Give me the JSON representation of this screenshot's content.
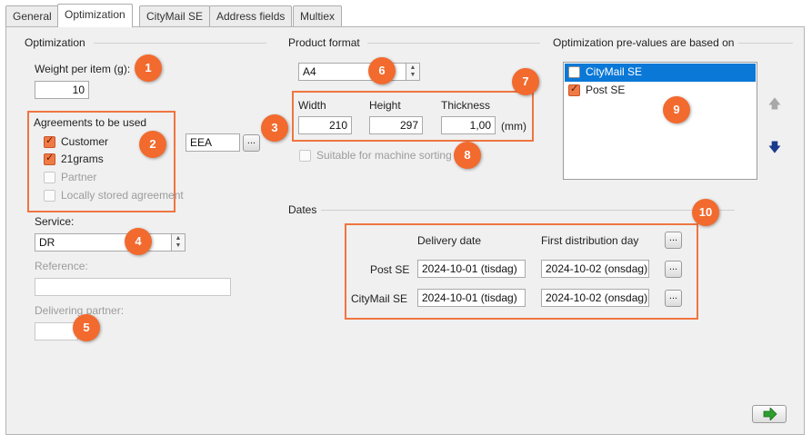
{
  "tabs": [
    {
      "label": "General",
      "active": false
    },
    {
      "label": "Optimization",
      "active": true
    },
    {
      "label": "CityMail SE",
      "active": false
    },
    {
      "label": "Address fields",
      "active": false
    },
    {
      "label": "Multiex",
      "active": false
    }
  ],
  "optimization": {
    "section_title": "Optimization",
    "weight_label": "Weight per item (g):",
    "weight_value": "10",
    "agreements_label": "Agreements to be used",
    "agreements": [
      {
        "label": "Customer",
        "checked": true,
        "enabled": true
      },
      {
        "label": "21grams",
        "checked": true,
        "enabled": true
      },
      {
        "label": "Partner",
        "checked": false,
        "enabled": false
      },
      {
        "label": "Locally stored agreement",
        "checked": false,
        "enabled": false
      }
    ],
    "eea_value": "EEA",
    "browse_label": "...",
    "service_label": "Service:",
    "service_value": "DR",
    "reference_label": "Reference:",
    "reference_value": "",
    "delivering_partner_label": "Delivering partner:",
    "delivering_partner_value": ""
  },
  "product_format": {
    "section_title": "Product format",
    "format_value": "A4",
    "width_label": "Width",
    "height_label": "Height",
    "thickness_label": "Thickness",
    "width_value": "210",
    "height_value": "297",
    "thickness_value": "1,00",
    "unit_label": "(mm)",
    "machine_sorting_label": "Suitable for machine sorting",
    "machine_sorting_checked": false
  },
  "prevalues": {
    "section_title": "Optimization pre-values are based on",
    "items": [
      {
        "label": "CityMail SE",
        "checked": false,
        "selected": true
      },
      {
        "label": "Post SE",
        "checked": true,
        "selected": false
      }
    ]
  },
  "dates": {
    "section_title": "Dates",
    "col_delivery": "Delivery date",
    "col_first": "First distribution day",
    "browse_label": "...",
    "rows": [
      {
        "label": "Post SE",
        "delivery": "2024-10-01 (tisdag)",
        "first": "2024-10-02 (onsdag)"
      },
      {
        "label": "CityMail SE",
        "delivery": "2024-10-01 (tisdag)",
        "first": "2024-10-02 (onsdag)"
      }
    ]
  },
  "badges": [
    "1",
    "2",
    "3",
    "4",
    "5",
    "6",
    "7",
    "8",
    "9",
    "10"
  ],
  "colors": {
    "accent": "#f26a2e",
    "selection": "#0a78d7",
    "go_arrow": "#2e9e2e",
    "down_arrow": "#1a3a8c"
  }
}
